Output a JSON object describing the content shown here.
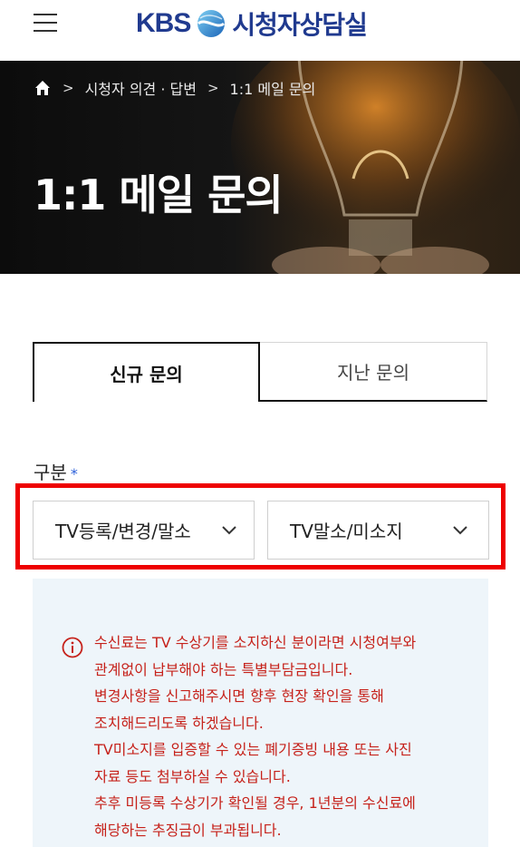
{
  "header": {
    "logo_brand": "KBS",
    "logo_title": "시청자상담실"
  },
  "breadcrumb": {
    "items": [
      "시청자 의견 · 답변",
      "1:1 메일 문의"
    ],
    "separator": ">"
  },
  "hero": {
    "title": "1:1 메일 문의"
  },
  "tabs": [
    {
      "label": "신규 문의",
      "active": true
    },
    {
      "label": "지난 문의",
      "active": false
    }
  ],
  "form": {
    "category_label": "구분",
    "required_mark": "*",
    "select_primary": "TV등록/변경/말소",
    "select_secondary": "TV말소/미소지"
  },
  "notice": {
    "lines": [
      "수신료는 TV 수상기를 소지하신 분이라면 시청여부와",
      "관계없이 납부해야 하는 특별부담금입니다.",
      "변경사항을 신고해주시면 향후 현장 확인을 통해",
      "조치해드리도록 하겠습니다.",
      "TV미소지를 입증할 수 있는 폐기증빙 내용 또는 사진",
      "자료 등도 첨부하실 수 있습니다.",
      "추후 미등록 수상기가 확인될 경우, 1년분의 수신료에",
      "해당하는 추징금이 부과됩니다."
    ]
  },
  "colors": {
    "brand": "#203a8f",
    "highlight": "#ee0000",
    "notice_text": "#c6221b",
    "notice_bg": "#eef5fa",
    "required": "#2b5fd9"
  },
  "icons": [
    "menu-icon",
    "globe-logo-icon",
    "home-icon",
    "chevron-down-icon",
    "info-icon"
  ]
}
